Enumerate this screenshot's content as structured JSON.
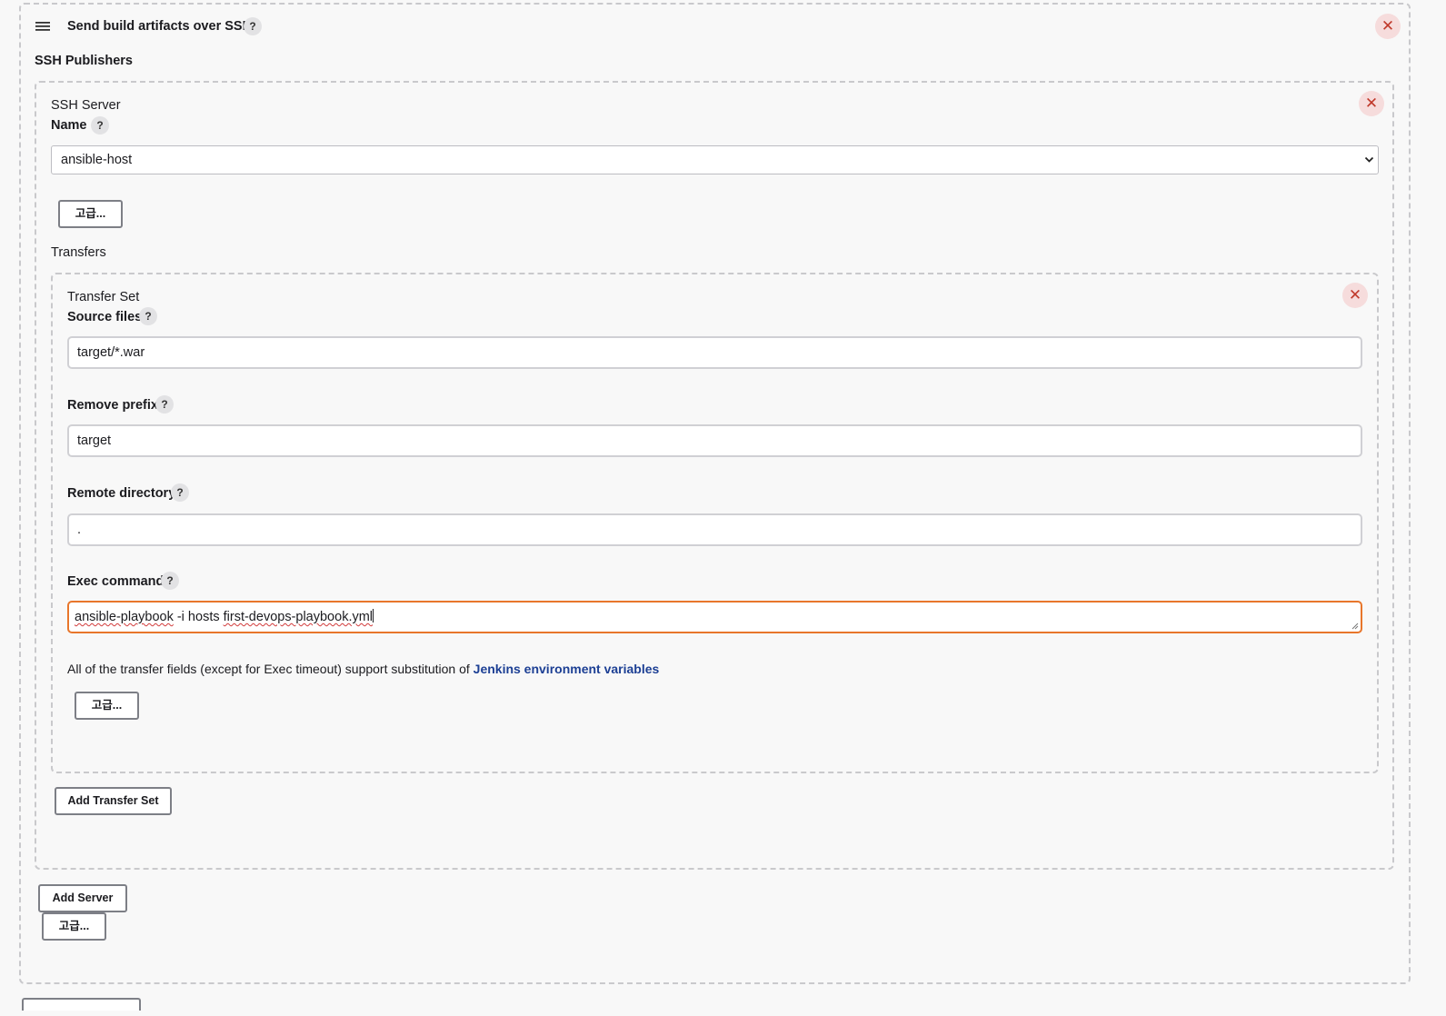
{
  "section": {
    "title": "Send build artifacts over SSH",
    "ssh_publishers_label": "SSH Publishers"
  },
  "server": {
    "heading": "SSH Server",
    "name_label": "Name",
    "name_value": "ansible-host",
    "advanced_label": "고급...",
    "transfers_label": "Transfers"
  },
  "transfer": {
    "heading": "Transfer Set",
    "source_files_label": "Source files",
    "source_files_value": "target/*.war",
    "remove_prefix_label": "Remove prefix",
    "remove_prefix_value": "target",
    "remote_directory_label": "Remote directory",
    "remote_directory_value": ".",
    "exec_command_label": "Exec command",
    "exec_command_part1": "ansible-playbook",
    "exec_command_part2": " -i hosts ",
    "exec_command_part3": "first-devops-playbook.yml",
    "note_text": "All of the transfer fields (except for Exec timeout) support substitution of ",
    "note_link": "Jenkins environment variables",
    "advanced_label": "고급..."
  },
  "buttons": {
    "add_transfer_set": "Add Transfer Set",
    "add_server": "Add Server",
    "advanced": "고급..."
  },
  "help_symbol": "?",
  "close_symbol": "✕",
  "colors": {
    "focus_border": "#e8762b",
    "link": "#1c3f94",
    "close_bg": "#f6dcdc",
    "close_fg": "#c0392b"
  }
}
